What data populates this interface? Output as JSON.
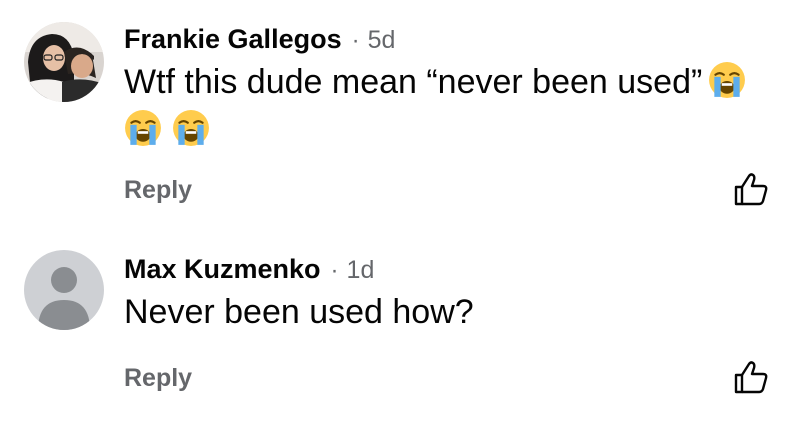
{
  "comments": [
    {
      "author": "Frankie Gallegos",
      "separator": "·",
      "time": "5d",
      "text": "Wtf this dude mean “never been used”",
      "emojis": [
        "loudly-crying-face-emoji",
        "loudly-crying-face-emoji",
        "loudly-crying-face-emoji"
      ],
      "reply_label": "Reply",
      "avatar": "profile-photo"
    },
    {
      "author": "Max Kuzmenko",
      "separator": "·",
      "time": "1d",
      "text": "Never been used how?",
      "reply_label": "Reply",
      "avatar": "default-avatar"
    }
  ],
  "icons": {
    "like": "thumbs-up-icon"
  },
  "colors": {
    "text": "#050505",
    "secondary": "#65676b",
    "emoji_face": "#ffcc4d",
    "tears": "#5dadec",
    "default_avatar_bg": "#ced0d4",
    "default_avatar_fg": "#8a8d91"
  }
}
